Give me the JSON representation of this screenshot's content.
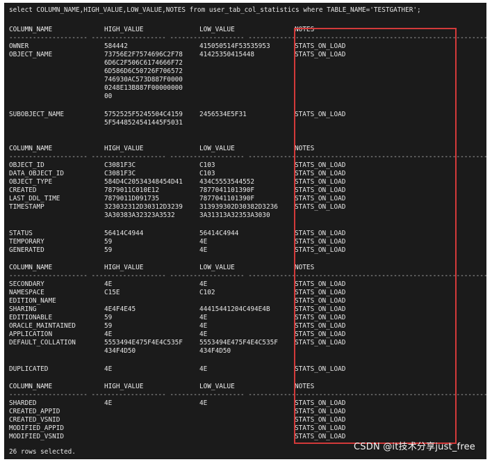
{
  "query": "select COLUMN_NAME,HIGH_VALUE,LOW_VALUE,NOTES from user_tab_col_statistics where TABLE_NAME='TESTGATHER';",
  "headers": [
    "COLUMN_NAME",
    "HIGH_VALUE",
    "LOW_VALUE",
    "NOTES"
  ],
  "rows": [
    {
      "c1": "OWNER",
      "c2": "584442",
      "c3": "415050514F53535953",
      "c4": "STATS_ON_LOAD"
    },
    {
      "c1": "OBJECT_NAME",
      "c2": "73756E2F7574696C2F78",
      "c3": "41425350415448",
      "c4": "STATS_ON_LOAD"
    },
    {
      "c1": "",
      "c2": "6D6C2F506C6174666F72",
      "c3": "",
      "c4": ""
    },
    {
      "c1": "",
      "c2": "6D586D6C50726F706572",
      "c3": "",
      "c4": ""
    },
    {
      "c1": "",
      "c2": "746930AC573D887F0000",
      "c3": "",
      "c4": ""
    },
    {
      "c1": "",
      "c2": "0248E13B887F00000000",
      "c3": "",
      "c4": ""
    },
    {
      "c1": "",
      "c2": "00",
      "c3": "",
      "c4": ""
    },
    {
      "c1": "SUBOBJECT_NAME",
      "c2": "5752525F5245504C4159",
      "c3": "2456534E5F31",
      "c4": "STATS_ON_LOAD"
    },
    {
      "c1": "",
      "c2": "5F5448524541445F5031",
      "c3": "",
      "c4": ""
    },
    {
      "c1": "OBJECT_ID",
      "c2": "C3081F3C",
      "c3": "C103",
      "c4": "STATS_ON_LOAD"
    },
    {
      "c1": "DATA_OBJECT_ID",
      "c2": "C3081F3C",
      "c3": "C103",
      "c4": "STATS_ON_LOAD"
    },
    {
      "c1": "OBJECT_TYPE",
      "c2": "584D4C20534348454D41",
      "c3": "434C5553544552",
      "c4": "STATS_ON_LOAD"
    },
    {
      "c1": "CREATED",
      "c2": "7879011C010E12",
      "c3": "7877041101390F",
      "c4": "STATS_ON_LOAD"
    },
    {
      "c1": "LAST_DDL_TIME",
      "c2": "7879011D091735",
      "c3": "7877041101390F",
      "c4": "STATS_ON_LOAD"
    },
    {
      "c1": "TIMESTAMP",
      "c2": "323032312D30312D3239",
      "c3": "313939302D30382D3236",
      "c4": "STATS_ON_LOAD"
    },
    {
      "c1": "",
      "c2": "3A30383A32323A3532",
      "c3": "3A31313A32353A3030",
      "c4": ""
    },
    {
      "c1": "STATUS",
      "c2": "56414C4944",
      "c3": "56414C4944",
      "c4": "STATS_ON_LOAD"
    },
    {
      "c1": "TEMPORARY",
      "c2": "59",
      "c3": "4E",
      "c4": "STATS_ON_LOAD"
    },
    {
      "c1": "GENERATED",
      "c2": "59",
      "c3": "4E",
      "c4": "STATS_ON_LOAD"
    },
    {
      "c1": "SECONDARY",
      "c2": "4E",
      "c3": "4E",
      "c4": "STATS_ON_LOAD"
    },
    {
      "c1": "NAMESPACE",
      "c2": "C15E",
      "c3": "C102",
      "c4": "STATS_ON_LOAD"
    },
    {
      "c1": "EDITION_NAME",
      "c2": "",
      "c3": "",
      "c4": "STATS_ON_LOAD"
    },
    {
      "c1": "SHARING",
      "c2": "4E4F4E45",
      "c3": "44415441204C494E4B",
      "c4": "STATS_ON_LOAD"
    },
    {
      "c1": "EDITIONABLE",
      "c2": "59",
      "c3": "4E",
      "c4": "STATS_ON_LOAD"
    },
    {
      "c1": "ORACLE_MAINTAINED",
      "c2": "59",
      "c3": "4E",
      "c4": "STATS_ON_LOAD"
    },
    {
      "c1": "APPLICATION",
      "c2": "4E",
      "c3": "4E",
      "c4": "STATS_ON_LOAD"
    },
    {
      "c1": "DEFAULT_COLLATION",
      "c2": "5553494E475F4E4C535F",
      "c3": "5553494E475F4E4C535F",
      "c4": "STATS_ON_LOAD"
    },
    {
      "c1": "",
      "c2": "434F4D50",
      "c3": "434F4D50",
      "c4": ""
    },
    {
      "c1": "DUPLICATED",
      "c2": "4E",
      "c3": "4E",
      "c4": "STATS_ON_LOAD"
    },
    {
      "c1": "SHARDED",
      "c2": "4E",
      "c3": "4E",
      "c4": "STATS_ON_LOAD"
    },
    {
      "c1": "CREATED_APPID",
      "c2": "",
      "c3": "",
      "c4": "STATS_ON_LOAD"
    },
    {
      "c1": "CREATED_VSNID",
      "c2": "",
      "c3": "",
      "c4": "STATS_ON_LOAD"
    },
    {
      "c1": "MODIFIED_APPID",
      "c2": "",
      "c3": "",
      "c4": "STATS_ON_LOAD"
    },
    {
      "c1": "MODIFIED_VSNID",
      "c2": "",
      "c3": "",
      "c4": "STATS_ON_LOAD"
    }
  ],
  "footer": "26 rows selected.",
  "watermark": "CSDN @it技术分享just_free",
  "colors": {
    "background": "#1b1b1b",
    "text": "#e6e6e6",
    "highlight": "#d33a3a"
  }
}
